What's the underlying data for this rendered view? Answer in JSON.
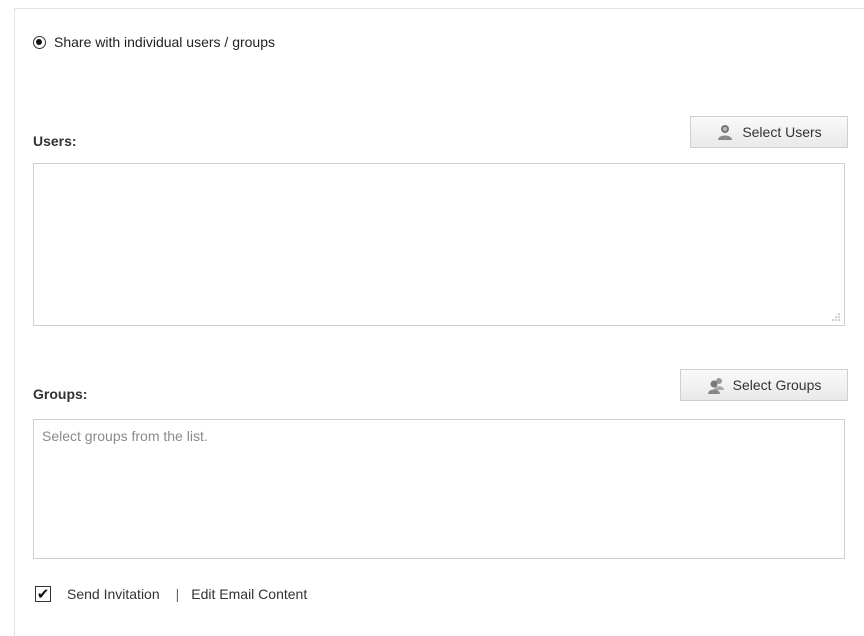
{
  "share_option": {
    "label": "Share with individual users / groups",
    "selected": true
  },
  "users": {
    "label": "Users:",
    "select_button": "Select Users",
    "value": ""
  },
  "groups": {
    "label": "Groups:",
    "select_button": "Select Groups",
    "placeholder": "Select groups from the list."
  },
  "invitation": {
    "checkbox_label": "Send Invitation",
    "checked": true,
    "separator": "|",
    "edit_link": "Edit Email Content"
  },
  "icons": {
    "users_button_icon": "user-icon",
    "groups_button_icon": "group-icon"
  }
}
